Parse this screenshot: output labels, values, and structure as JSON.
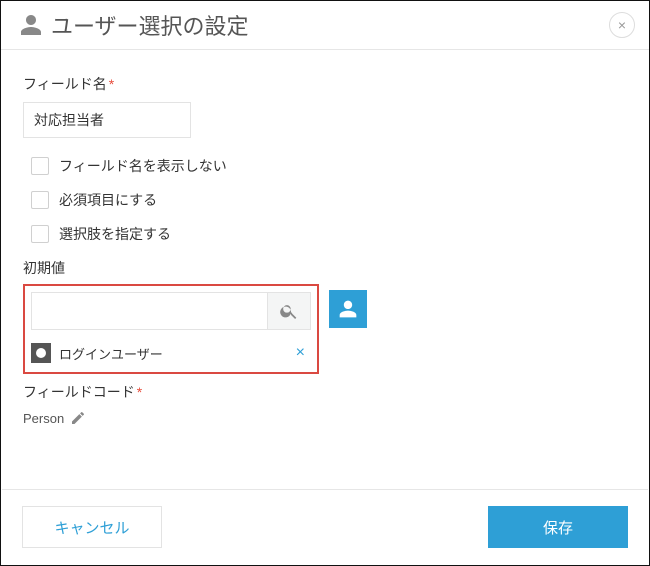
{
  "header": {
    "title": "ユーザー選択の設定"
  },
  "fieldName": {
    "label": "フィールド名",
    "value": "対応担当者"
  },
  "options": {
    "hideLabel": "フィールド名を表示しない",
    "required": "必須項目にする",
    "limitChoices": "選択肢を指定する"
  },
  "initial": {
    "label": "初期値",
    "searchPlaceholder": "",
    "chip": "ログインユーザー"
  },
  "fieldCode": {
    "label": "フィールドコード",
    "value": "Person"
  },
  "footer": {
    "cancel": "キャンセル",
    "save": "保存"
  }
}
